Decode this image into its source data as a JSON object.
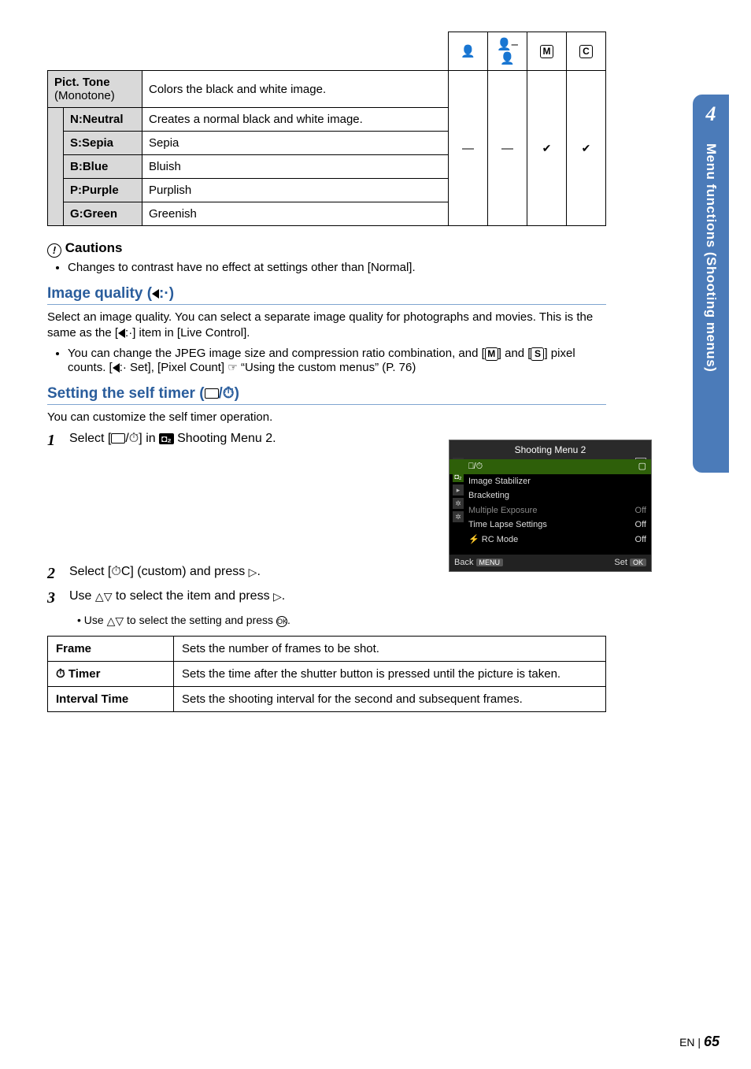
{
  "tableHeader": {
    "col3": "👤",
    "col4": "👤–👤",
    "col5": "M",
    "col6": "C"
  },
  "pictTone": {
    "label": "Pict. Tone",
    "sublabel": "(Monotone)",
    "desc": "Colors the black and white image.",
    "rows": [
      {
        "name": "N:Neutral",
        "desc": "Creates a normal black and white image."
      },
      {
        "name": "S:Sepia",
        "desc": "Sepia"
      },
      {
        "name": "B:Blue",
        "desc": "Bluish"
      },
      {
        "name": "P:Purple",
        "desc": "Purplish"
      },
      {
        "name": "G:Green",
        "desc": "Greenish"
      }
    ],
    "dash": "―",
    "check": "✔"
  },
  "cautions": {
    "title": "Cautions",
    "item": "Changes to contrast have no effect at settings other than [Normal]."
  },
  "imgQuality": {
    "title": "Image quality (",
    "titleSuffix": ")",
    "body1": "Select an image quality. You can select a separate image quality for photographs and movies. This is the same as the [",
    "body1b": "] item in [Live Control].",
    "bullet": "You can change the JPEG image size and compression ratio combination, and [",
    "bulletM": "M",
    "bulletMid": "] and [",
    "bulletS": "S",
    "bulletMid2": "] pixel counts. [",
    "bulletMid3": " Set], [Pixel Count] ",
    "bulletRef": "“Using the custom menus” (P. 76)"
  },
  "selfTimer": {
    "title": "Setting the self timer (",
    "titleSuffix": ")",
    "intro": "You can customize the self timer operation.",
    "step1a": "Select [",
    "step1b": "] in ",
    "step1c": " Shooting Menu 2.",
    "step2a": "Select [",
    "step2b": "C] (custom) and press ",
    "step2c": ".",
    "step3a": "Use ",
    "step3b": " to select the item and press ",
    "step3c": ".",
    "step3sub1": "Use ",
    "step3sub2": " to select the setting and press ",
    "step3sub3": "."
  },
  "menuShot": {
    "title": "Shooting Menu 2",
    "items": [
      {
        "label": "⎕/⏱",
        "val": "▢"
      },
      {
        "label": "Image Stabilizer",
        "val": ""
      },
      {
        "label": "Bracketing",
        "val": ""
      },
      {
        "label": "Multiple Exposure",
        "val": "Off"
      },
      {
        "label": "Time Lapse Settings",
        "val": "Off"
      },
      {
        "label": "⚡ RC Mode",
        "val": "Off"
      }
    ],
    "back": "Back",
    "backBtn": "MENU",
    "set": "Set",
    "setBtn": "OK"
  },
  "params": [
    {
      "name": "Frame",
      "desc": "Sets the number of frames to be shot."
    },
    {
      "name": "⏱ Timer",
      "desc": "Sets the time after the shutter button is pressed until the picture is taken."
    },
    {
      "name": "Interval Time",
      "desc": "Sets the shooting interval for the second and subsequent frames."
    }
  ],
  "sideTab": {
    "num": "4",
    "text": "Menu functions (Shooting menus)"
  },
  "footer": {
    "lang": "EN",
    "page": "65"
  }
}
